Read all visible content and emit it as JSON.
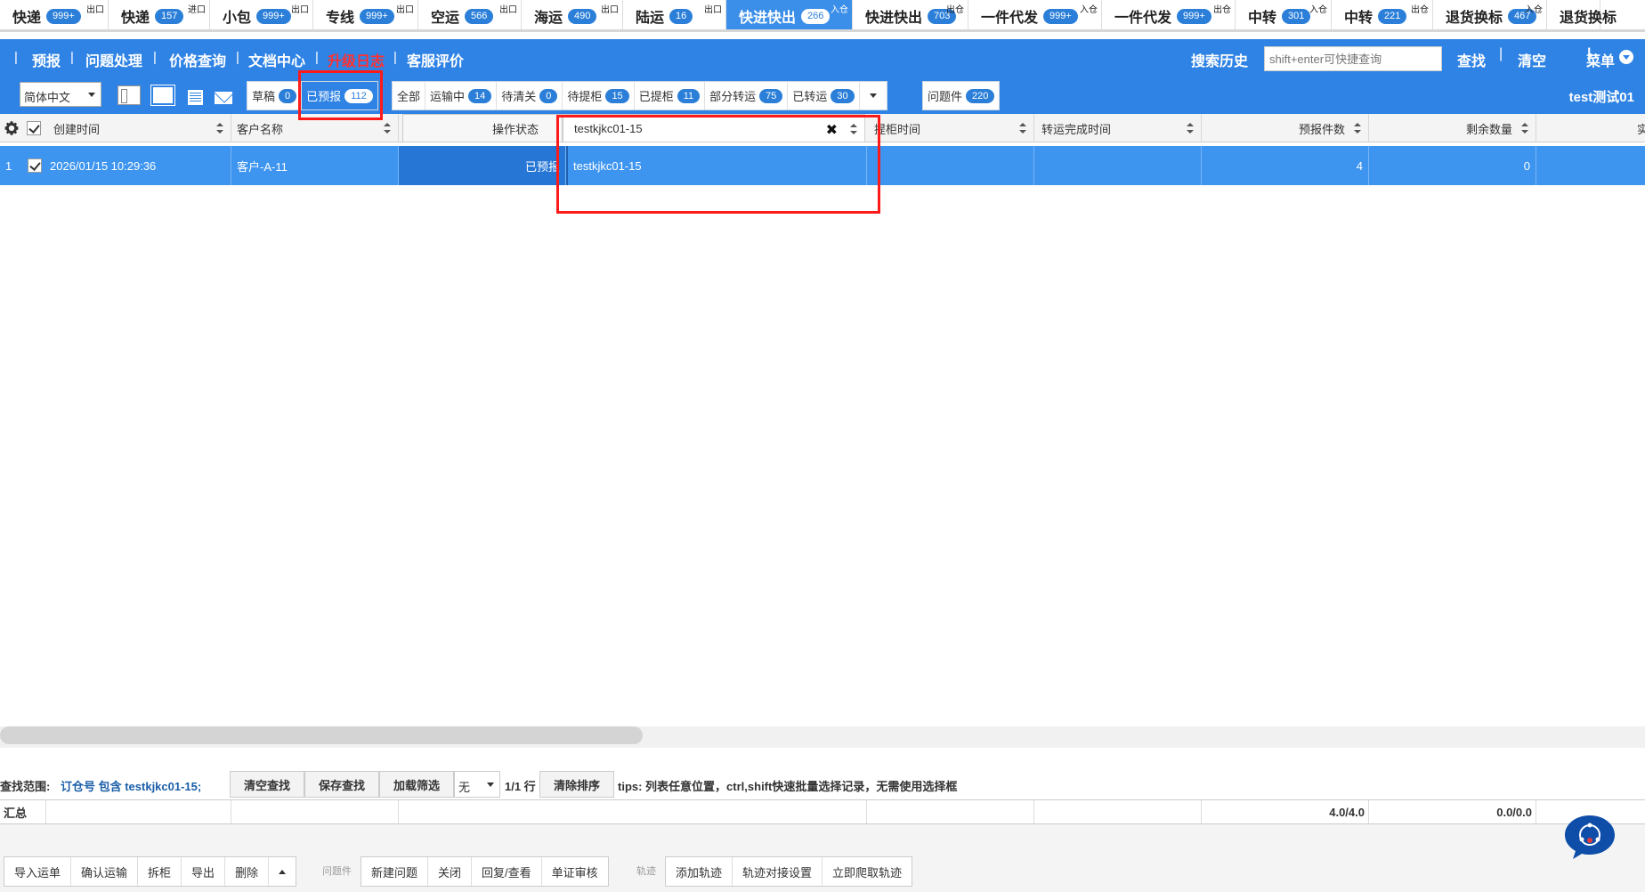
{
  "top_tabs": [
    {
      "label": "快递",
      "badge": "999+",
      "tag": "出口"
    },
    {
      "label": "快递",
      "badge": "157",
      "tag": "进口"
    },
    {
      "label": "小包",
      "badge": "999+",
      "tag": "出口"
    },
    {
      "label": "专线",
      "badge": "999+",
      "tag": "出口"
    },
    {
      "label": "空运",
      "badge": "566",
      "tag": "出口"
    },
    {
      "label": "海运",
      "badge": "490",
      "tag": "出口"
    },
    {
      "label": "陆运",
      "badge": "16",
      "tag": "出口"
    },
    {
      "label": "快进快出",
      "badge": "266",
      "tag": "入仓",
      "active": true
    },
    {
      "label": "快进快出",
      "badge": "703",
      "tag": "出仓"
    },
    {
      "label": "一件代发",
      "badge": "999+",
      "tag": "入仓"
    },
    {
      "label": "一件代发",
      "badge": "999+",
      "tag": "出仓"
    },
    {
      "label": "中转",
      "badge": "301",
      "tag": "入仓"
    },
    {
      "label": "中转",
      "badge": "221",
      "tag": "出仓"
    },
    {
      "label": "退货换标",
      "badge": "467",
      "tag": "入仓"
    },
    {
      "label": "退货换标",
      "badge": "",
      "tag": ""
    }
  ],
  "nav": {
    "items": [
      "预报",
      "问题处理",
      "价格查询",
      "文档中心",
      "升级日志",
      "客服评价"
    ],
    "separator": "|",
    "search_history": "搜索历史",
    "search_placeholder": "shift+enter可快捷查询",
    "find": "查找",
    "clear": "清空",
    "menu": "菜单"
  },
  "filters": {
    "language": "简体中文",
    "group1": [
      {
        "label": "草稿",
        "badge": "0"
      },
      {
        "label": "已预报",
        "badge": "112",
        "active": true
      }
    ],
    "group2": [
      {
        "label": "全部",
        "badge": ""
      },
      {
        "label": "运输中",
        "badge": "14"
      },
      {
        "label": "待清关",
        "badge": "0"
      },
      {
        "label": "待提柜",
        "badge": "15"
      },
      {
        "label": "已提柜",
        "badge": "11"
      },
      {
        "label": "部分转运",
        "badge": "75"
      },
      {
        "label": "已转运",
        "badge": "30"
      }
    ],
    "group3": [
      {
        "label": "问题件",
        "badge": "220"
      }
    ],
    "user": "test测试01"
  },
  "grid": {
    "columns": [
      "创建时间",
      "客户名称",
      "操作状态",
      "testkjkc01-15",
      "提柜时间",
      "转运完成时间",
      "预报件数",
      "剩余数量",
      "实收"
    ],
    "row": {
      "index": "1",
      "created": "2026/01/15 10:29:36",
      "customer": "客户-A-11",
      "status": "已预报",
      "order_no": "testkjkc01-15",
      "pickup_time": "",
      "transfer_time": "",
      "forecast_qty": "4",
      "remaining": "0"
    }
  },
  "status_bar": {
    "scope_label": "查找范围:",
    "scope_value": "订仓号 包含 testkjkc01-15;",
    "clear_search": "清空查找",
    "save_search": "保存查找",
    "load_filter": "加载筛选",
    "filter_select": "无",
    "pages": "1/1 行",
    "clear_sort": "清除排序",
    "tips": "tips: 列表任意位置，ctrl,shift快速批量选择记录，无需使用选择框"
  },
  "summary": {
    "label": "汇总",
    "forecast_total": "4.0/4.0",
    "remaining_total": "0.0/0.0"
  },
  "toolbar": {
    "group1": [
      "导入运单",
      "确认运输",
      "拆柜",
      "导出",
      "删除"
    ],
    "problem_label": "问题件",
    "group2": [
      "新建问题",
      "关闭",
      "回复/查看",
      "单证审核"
    ],
    "track_label": "轨迹",
    "group3": [
      "添加轨迹",
      "轨迹对接设置",
      "立即爬取轨迹"
    ]
  },
  "colors": {
    "accent": "#2f83e4",
    "row_selected": "#3d95f0",
    "badge": "#2b7fd9",
    "highlight_box": "#ff1a1a",
    "nav_red": "#ff3030"
  }
}
